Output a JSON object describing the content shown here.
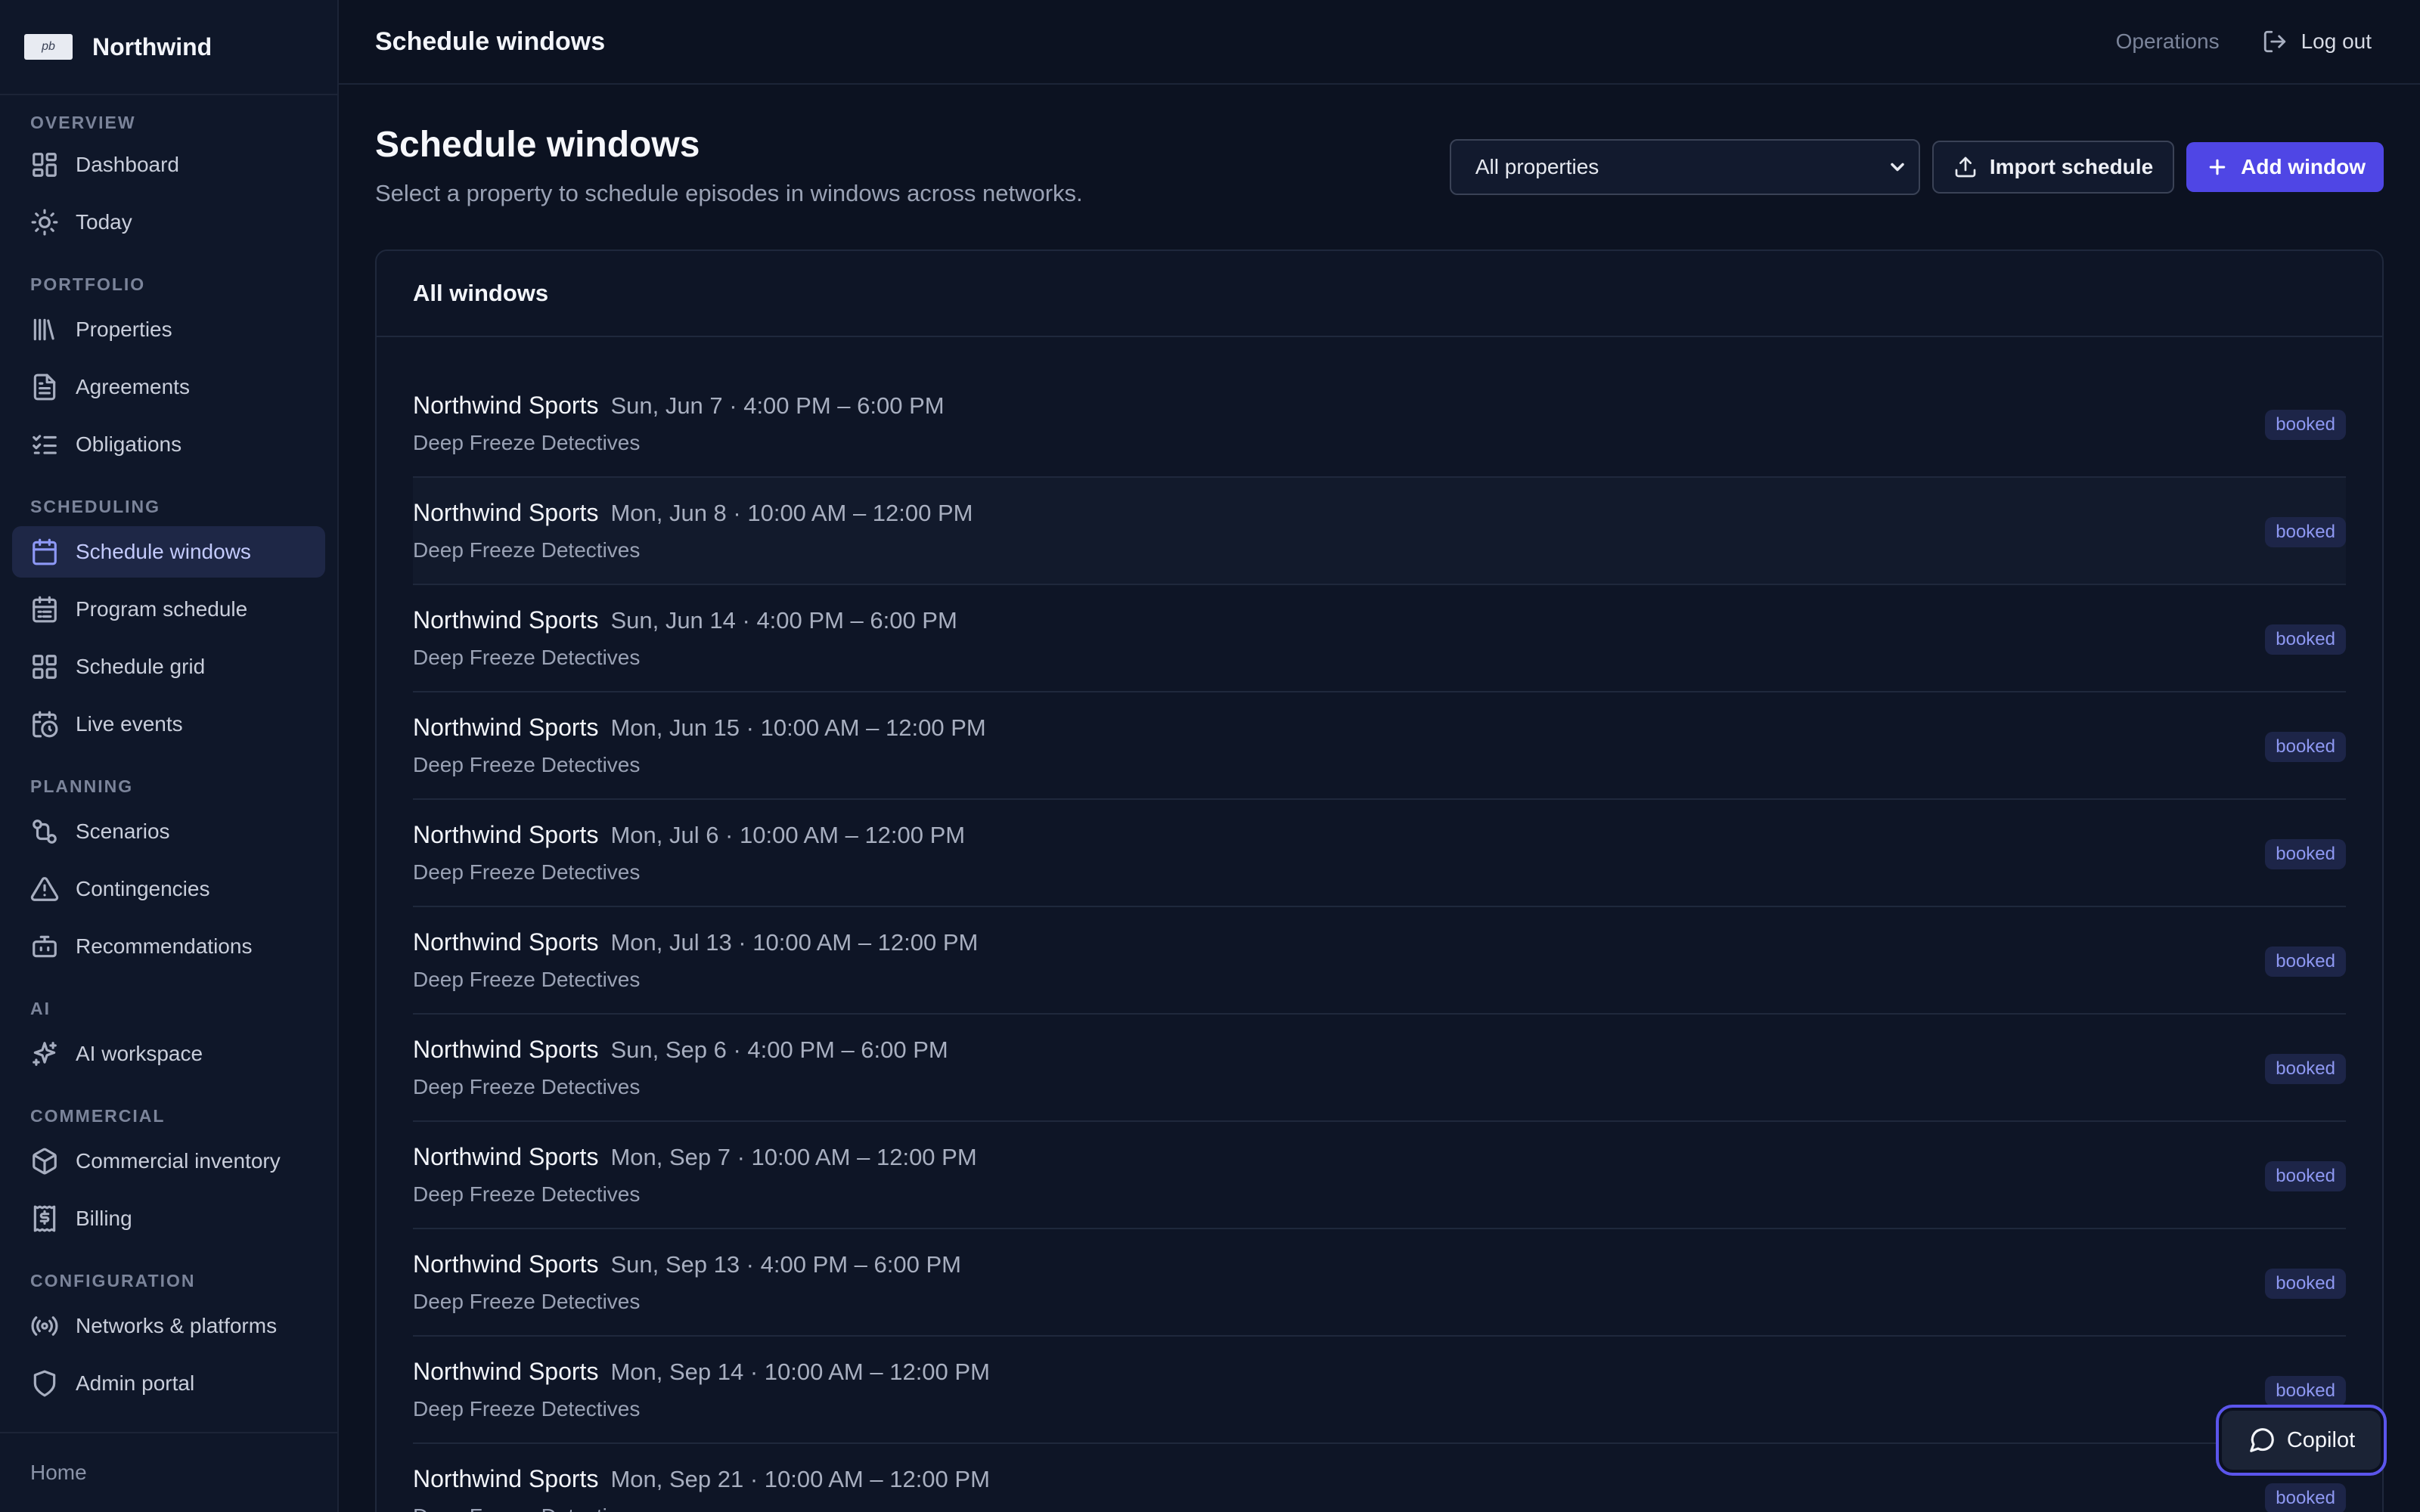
{
  "app": {
    "brand_name": "Northwind",
    "logo_text": "pb"
  },
  "sidebar": {
    "sections": [
      {
        "label": "OVERVIEW",
        "items": [
          {
            "label": "Dashboard",
            "icon": "dashboard-icon"
          },
          {
            "label": "Today",
            "icon": "sun-icon"
          }
        ]
      },
      {
        "label": "PORTFOLIO",
        "items": [
          {
            "label": "Properties",
            "icon": "library-icon"
          },
          {
            "label": "Agreements",
            "icon": "document-icon"
          },
          {
            "label": "Obligations",
            "icon": "checklist-icon"
          }
        ]
      },
      {
        "label": "SCHEDULING",
        "items": [
          {
            "label": "Schedule windows",
            "icon": "calendar-icon",
            "active": true
          },
          {
            "label": "Program schedule",
            "icon": "calendar-list-icon"
          },
          {
            "label": "Schedule grid",
            "icon": "grid-icon"
          },
          {
            "label": "Live events",
            "icon": "calendar-clock-icon"
          }
        ]
      },
      {
        "label": "PLANNING",
        "items": [
          {
            "label": "Scenarios",
            "icon": "branch-icon"
          },
          {
            "label": "Contingencies",
            "icon": "warning-icon"
          },
          {
            "label": "Recommendations",
            "icon": "bot-icon"
          }
        ]
      },
      {
        "label": "AI",
        "items": [
          {
            "label": "AI workspace",
            "icon": "sparkles-icon"
          }
        ]
      },
      {
        "label": "COMMERCIAL",
        "items": [
          {
            "label": "Commercial inventory",
            "icon": "box-icon"
          },
          {
            "label": "Billing",
            "icon": "dollar-receipt-icon"
          }
        ]
      },
      {
        "label": "CONFIGURATION",
        "items": [
          {
            "label": "Networks & platforms",
            "icon": "broadcast-icon"
          },
          {
            "label": "Admin portal",
            "icon": "shield-icon"
          }
        ]
      }
    ],
    "footer_label": "Home"
  },
  "topbar": {
    "title": "Schedule windows",
    "operations_label": "Operations",
    "logout_label": "Log out"
  },
  "page": {
    "title": "Schedule windows",
    "subtitle": "Select a property to schedule episodes in windows across networks.",
    "property_select": "All properties",
    "import_label": "Import schedule",
    "add_label": "Add window"
  },
  "card": {
    "title": "All windows",
    "rows": [
      {
        "network": "Northwind Sports",
        "time": "Sun, Jun 7 · 4:00 PM – 6:00 PM",
        "program": "Deep Freeze Detectives",
        "status": "booked"
      },
      {
        "network": "Northwind Sports",
        "time": "Mon, Jun 8 · 10:00 AM – 12:00 PM",
        "program": "Deep Freeze Detectives",
        "status": "booked"
      },
      {
        "network": "Northwind Sports",
        "time": "Sun, Jun 14 · 4:00 PM – 6:00 PM",
        "program": "Deep Freeze Detectives",
        "status": "booked"
      },
      {
        "network": "Northwind Sports",
        "time": "Mon, Jun 15 · 10:00 AM – 12:00 PM",
        "program": "Deep Freeze Detectives",
        "status": "booked"
      },
      {
        "network": "Northwind Sports",
        "time": "Mon, Jul 6 · 10:00 AM – 12:00 PM",
        "program": "Deep Freeze Detectives",
        "status": "booked"
      },
      {
        "network": "Northwind Sports",
        "time": "Mon, Jul 13 · 10:00 AM – 12:00 PM",
        "program": "Deep Freeze Detectives",
        "status": "booked"
      },
      {
        "network": "Northwind Sports",
        "time": "Sun, Sep 6 · 4:00 PM – 6:00 PM",
        "program": "Deep Freeze Detectives",
        "status": "booked"
      },
      {
        "network": "Northwind Sports",
        "time": "Mon, Sep 7 · 10:00 AM – 12:00 PM",
        "program": "Deep Freeze Detectives",
        "status": "booked"
      },
      {
        "network": "Northwind Sports",
        "time": "Sun, Sep 13 · 4:00 PM – 6:00 PM",
        "program": "Deep Freeze Detectives",
        "status": "booked"
      },
      {
        "network": "Northwind Sports",
        "time": "Mon, Sep 14 · 10:00 AM – 12:00 PM",
        "program": "Deep Freeze Detectives",
        "status": "booked"
      },
      {
        "network": "Northwind Sports",
        "time": "Mon, Sep 21 · 10:00 AM – 12:00 PM",
        "program": "Deep Freeze Detectives",
        "status": "booked"
      }
    ]
  },
  "copilot": {
    "label": "Copilot"
  },
  "colors": {
    "accent": "#4f46e5",
    "background": "#0c1221",
    "badge_text": "#8e98f2"
  }
}
